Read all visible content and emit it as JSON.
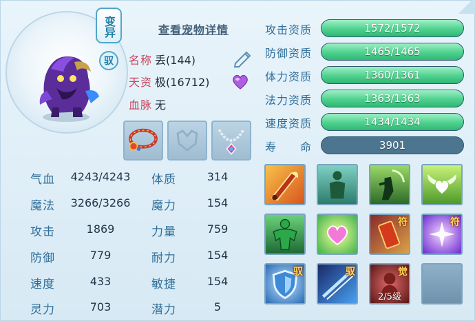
{
  "header": {
    "variant_badge": "变异",
    "tame_badge": "驭",
    "detail_link": "查看宠物详情"
  },
  "info": {
    "name_label": "名称",
    "name_value": "丢(144)",
    "talent_label": "天资",
    "talent_value": "极(16712)",
    "bloodline_label": "血脉",
    "bloodline_value": "无"
  },
  "equipment": [
    {
      "icon": "red-bracelet-icon"
    },
    {
      "icon": "empty-slot-icon"
    },
    {
      "icon": "silver-necklace-icon"
    }
  ],
  "stats": {
    "hp_label": "气血",
    "hp_value": "4243/4243",
    "constitution_label": "体质",
    "constitution_value": "314",
    "mp_label": "魔法",
    "mp_value": "3266/3266",
    "magic_label": "魔力",
    "magic_value": "154",
    "attack_label": "攻击",
    "attack_value": "1869",
    "strength_label": "力量",
    "strength_value": "759",
    "defense_label": "防御",
    "defense_value": "779",
    "endurance_label": "耐力",
    "endurance_value": "154",
    "speed_label": "速度",
    "speed_value": "433",
    "agility_label": "敏捷",
    "agility_value": "154",
    "spirit_label": "灵力",
    "spirit_value": "703",
    "potential_label": "潜力",
    "potential_value": "5"
  },
  "aptitudes": {
    "attack": {
      "label": "攻击资质",
      "value": "1572/1572",
      "fill": 1.0
    },
    "defense": {
      "label": "防御资质",
      "value": "1465/1465",
      "fill": 1.0
    },
    "stamina": {
      "label": "体力资质",
      "value": "1360/1361",
      "fill": 0.999
    },
    "magic": {
      "label": "法力资质",
      "value": "1363/1363",
      "fill": 1.0
    },
    "speed": {
      "label": "速度资质",
      "value": "1434/1434",
      "fill": 1.0
    },
    "life": {
      "label": "寿　　命",
      "value": "3901"
    }
  },
  "skills": [
    {
      "icon": "flame-sword-icon",
      "tag": ""
    },
    {
      "icon": "green-figure-icon",
      "tag": ""
    },
    {
      "icon": "warrior-silhouette-icon",
      "tag": ""
    },
    {
      "icon": "winged-heart-icon",
      "tag": ""
    },
    {
      "icon": "muscle-man-icon",
      "tag": ""
    },
    {
      "icon": "heart-glow-icon",
      "tag": ""
    },
    {
      "icon": "talisman-icon",
      "tag": "符"
    },
    {
      "icon": "purple-burst-icon",
      "tag": "符"
    },
    {
      "icon": "shield-icon",
      "tag": "驭"
    },
    {
      "icon": "blue-slash-icon",
      "tag": "驭"
    },
    {
      "icon": "awaken-icon",
      "tag": "觉",
      "level": "2/5级"
    },
    {
      "icon": "empty-skill-icon",
      "tag": ""
    }
  ],
  "colors": {
    "label_red": "#c8465e",
    "label_blue": "#2f6f9a",
    "bar_green": "#4fd18e",
    "bar_dark": "#3e6a85"
  }
}
